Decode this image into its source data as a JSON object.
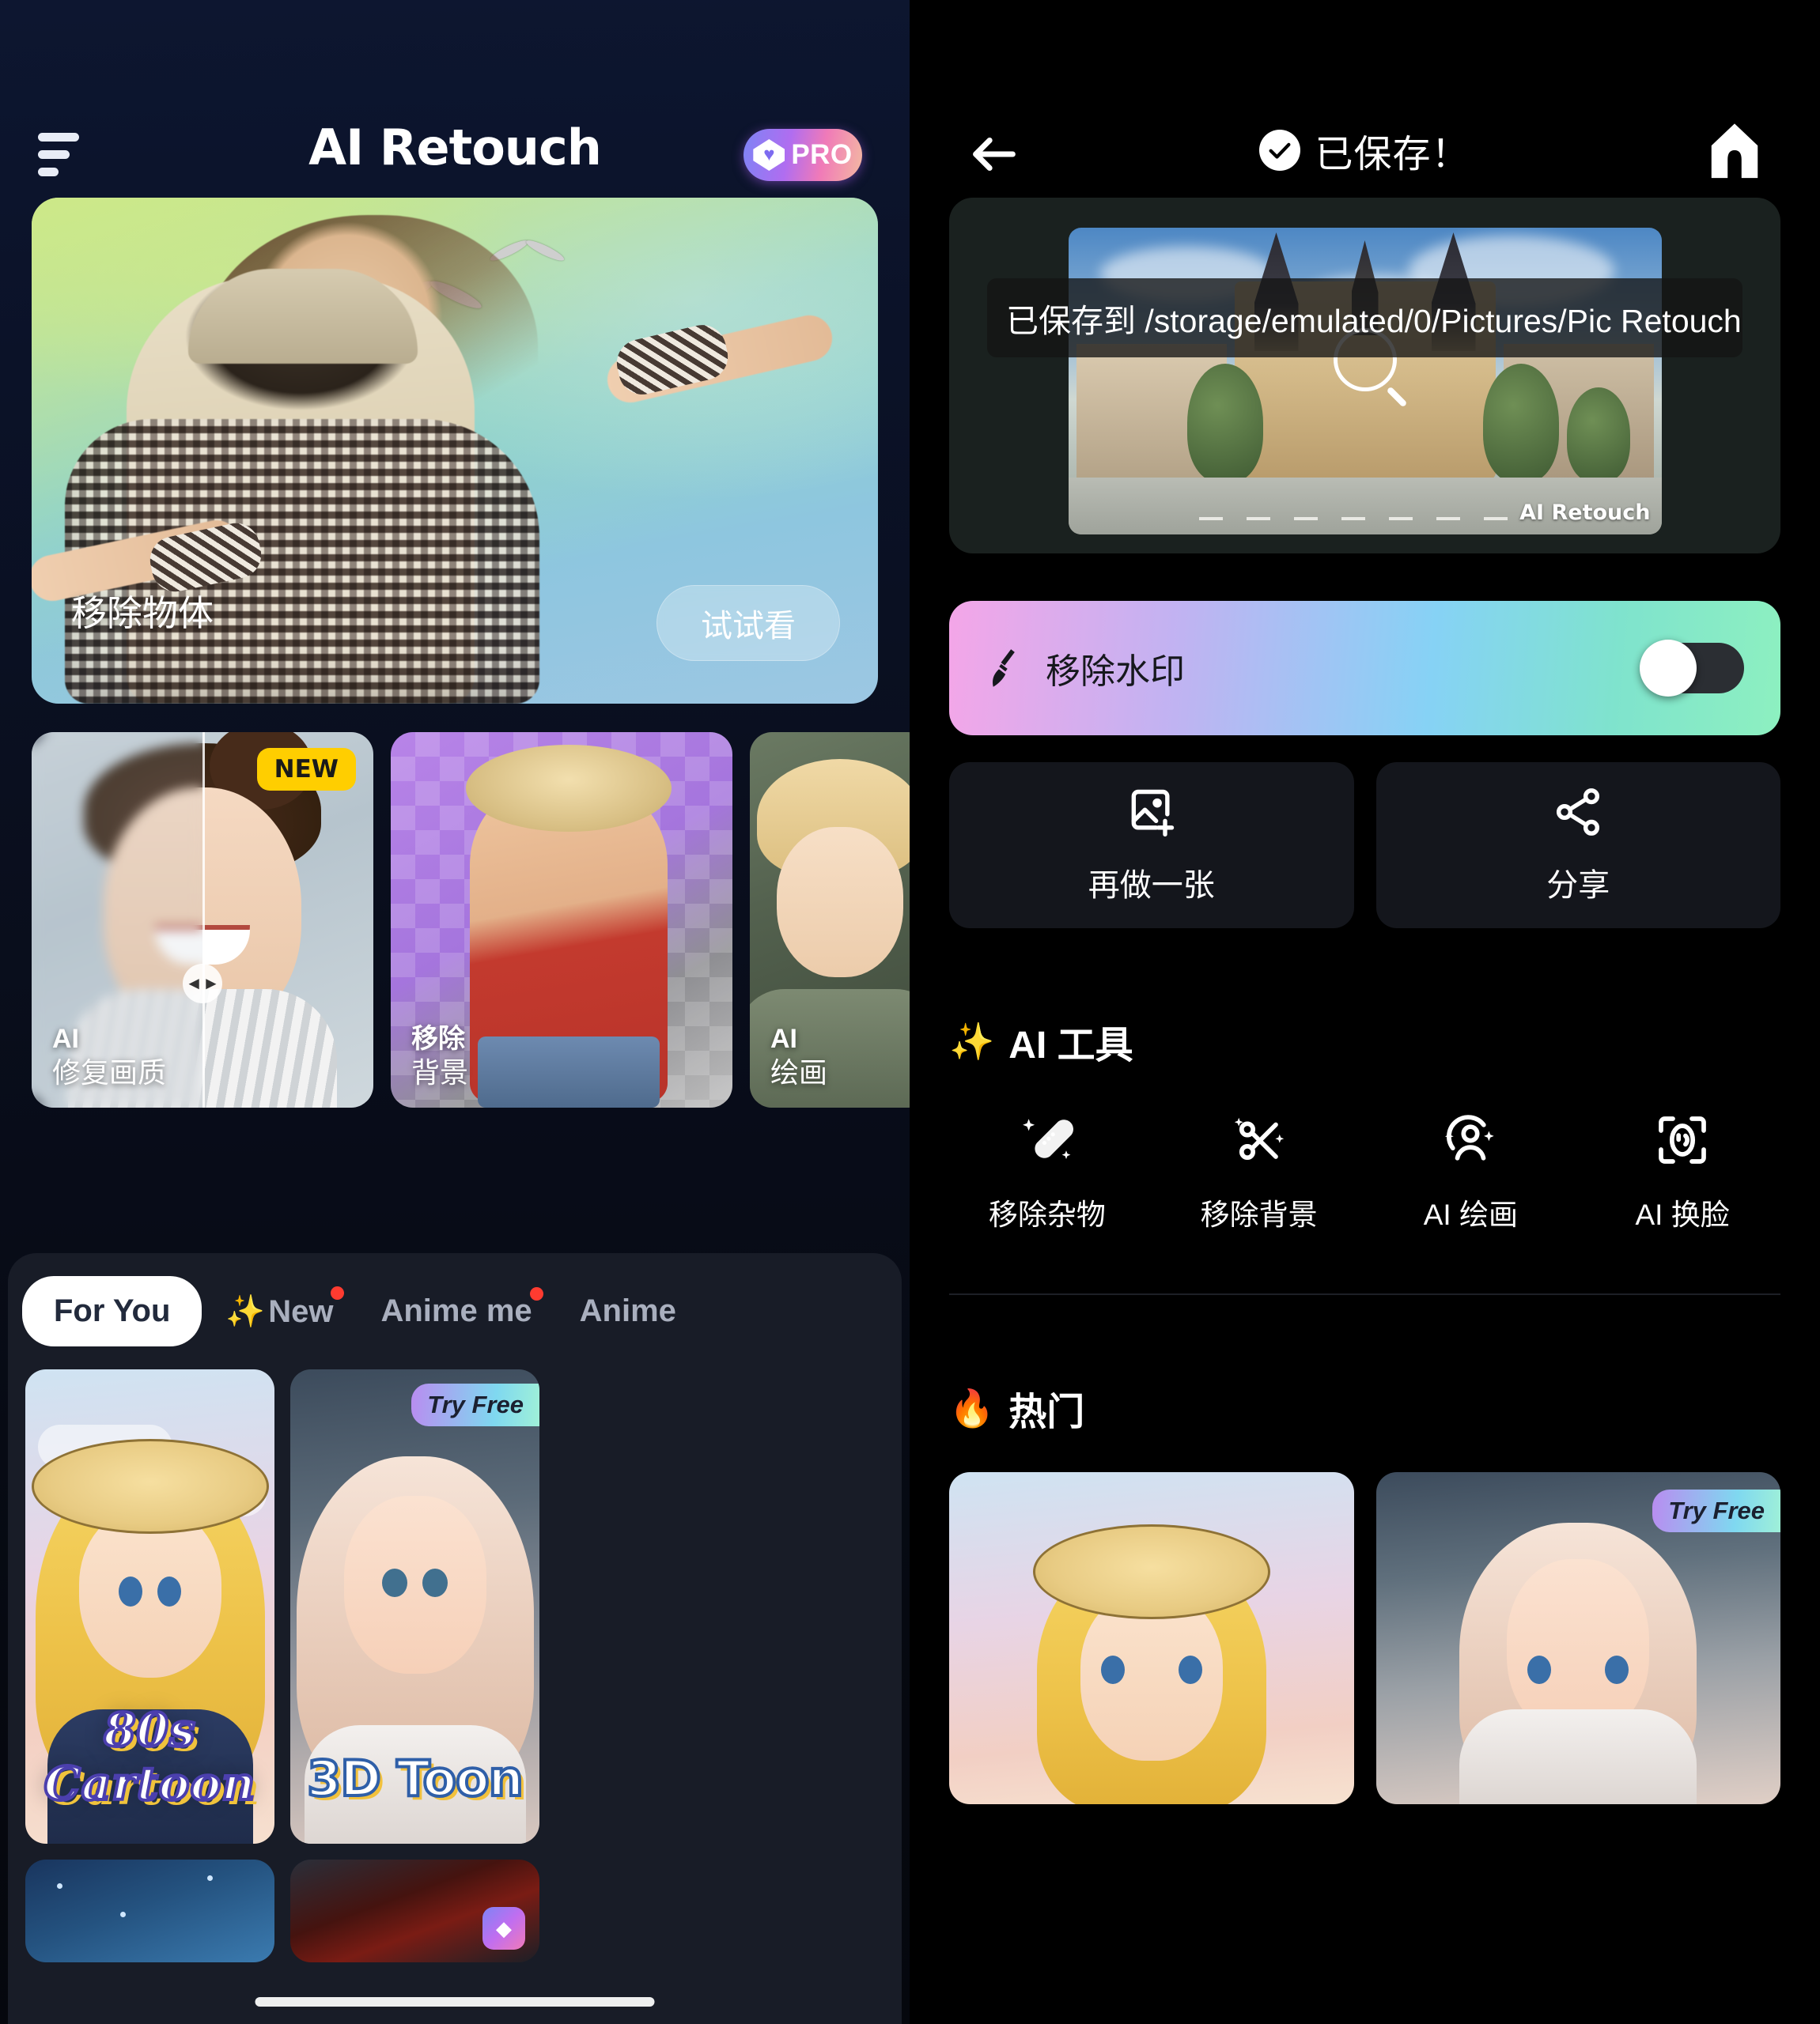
{
  "left_screen": {
    "header": {
      "menu_icon": "hamburger-menu-icon",
      "title": "AI Retouch",
      "pro_badge": {
        "label": "PRO",
        "icon": "diamond-icon"
      }
    },
    "hero_card": {
      "label": "移除物体",
      "button": "试试看"
    },
    "feature_cards": [
      {
        "badge": "NEW",
        "line1": "AI",
        "line2": "修复画质"
      },
      {
        "badge": "",
        "line1": "移除",
        "line2": "背景"
      },
      {
        "badge": "",
        "line1": "AI",
        "line2": "绘画"
      }
    ],
    "tabs": [
      {
        "label": "For You",
        "active": true,
        "sparkle": false,
        "dot": false
      },
      {
        "label": "New",
        "active": false,
        "sparkle": true,
        "dot": true
      },
      {
        "label": "Anime me",
        "active": false,
        "sparkle": false,
        "dot": true
      },
      {
        "label": "Anime",
        "active": false,
        "sparkle": false,
        "dot": false
      }
    ],
    "gallery": [
      {
        "title": "80s Cartoon",
        "badge": ""
      },
      {
        "title": "3D Toon",
        "badge": "Try Free"
      }
    ]
  },
  "right_screen": {
    "header": {
      "back_icon": "back-arrow-icon",
      "status_icon": "check-circle-icon",
      "status_text": "已保存！",
      "home_icon": "home-icon"
    },
    "preview": {
      "watermark_bg": "AI Retouch",
      "toast": "已保存到 /storage/emulated/0/Pictures/Pic Retouch",
      "image_watermark": "AI Retouch",
      "zoom_icon": "magnifier-icon"
    },
    "watermark_row": {
      "icon": "broom-icon",
      "label": "移除水印",
      "toggle_state": "off"
    },
    "actions": [
      {
        "icon": "add-image-icon",
        "label": "再做一张"
      },
      {
        "icon": "share-icon",
        "label": "分享"
      }
    ],
    "ai_tools": {
      "emoji": "✨",
      "title": "AI 工具",
      "items": [
        {
          "icon": "bandage-sparkle-icon",
          "label": "移除杂物"
        },
        {
          "icon": "scissors-sparkle-icon",
          "label": "移除背景"
        },
        {
          "icon": "person-sparkle-icon",
          "label": "AI 绘画"
        },
        {
          "icon": "face-scan-icon",
          "label": "AI 换脸"
        }
      ]
    },
    "hot": {
      "emoji": "🔥",
      "title": "热门",
      "items": [
        {
          "badge": ""
        },
        {
          "badge": "Try Free"
        }
      ]
    }
  },
  "colors": {
    "accent_pink": "#f4a6e8",
    "accent_cyan": "#86d2f5",
    "accent_green": "#8df0c0",
    "badge_yellow": "#FFCE00",
    "dot_red": "#ff3b30",
    "dark_bg": "#000000",
    "card_bg": "#14161c"
  }
}
